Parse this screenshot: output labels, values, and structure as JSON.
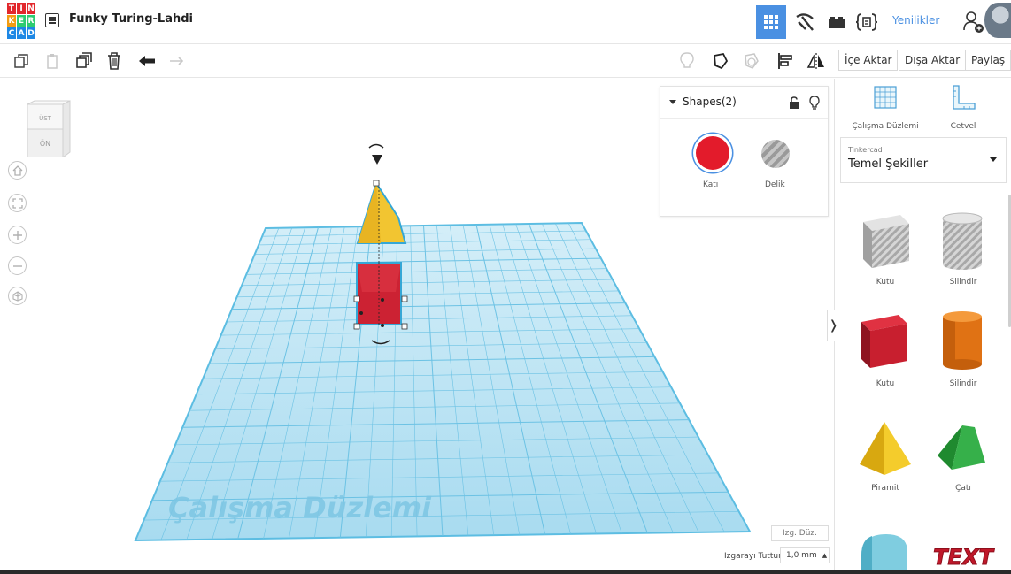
{
  "app": {
    "logo_letters": [
      "T",
      "I",
      "N",
      "K",
      "E",
      "R",
      "C",
      "A",
      "D"
    ],
    "design_title": "Funky Turing-Lahdi"
  },
  "topbar": {
    "news_label": "Yenilikler",
    "views": [
      {
        "name": "3d-design",
        "icon": "grid-icon",
        "active": true
      },
      {
        "name": "circuits",
        "icon": "pickaxe-icon",
        "active": false
      },
      {
        "name": "bricks",
        "icon": "brick-icon",
        "active": false
      },
      {
        "name": "codeblocks",
        "icon": "code-braces-icon",
        "active": false
      }
    ]
  },
  "toolbar": {
    "import_label": "İçe Aktar",
    "export_label": "Dışa Aktar",
    "share_label": "Paylaş"
  },
  "viewcube": {
    "top_label": "ÜST",
    "front_label": "ÖN"
  },
  "workplane": {
    "watermark": "Çalışma Düzlemi"
  },
  "shapes_panel": {
    "title": "Shapes(2)",
    "solid_label": "Katı",
    "hole_label": "Delik",
    "solid_color": "#e31b2b"
  },
  "sidebar": {
    "workplane_tool_label": "Çalışma Düzlemi",
    "ruler_tool_label": "Cetvel",
    "library_source": "Tinkercad",
    "library_name": "Temel Şekiller",
    "shapes": [
      {
        "label": "Kutu",
        "icon": "hole-box-icon"
      },
      {
        "label": "Silindir",
        "icon": "hole-cylinder-icon"
      },
      {
        "label": "Kutu",
        "icon": "box-icon"
      },
      {
        "label": "Silindir",
        "icon": "cylinder-icon"
      },
      {
        "label": "Piramit",
        "icon": "pyramid-icon"
      },
      {
        "label": "Çatı",
        "icon": "roof-icon"
      },
      {
        "label": "",
        "icon": "round-roof-icon"
      },
      {
        "label": "",
        "icon": "text-icon"
      }
    ]
  },
  "grid_controls": {
    "edit_grid_label": "Izg. Düz.",
    "snap_label": "Izgarayı Tuttur",
    "snap_value": "1,0 mm"
  },
  "colors": {
    "accent": "#4a90e2",
    "workplane": "#9fd8ee",
    "box_red": "#cc2233",
    "pyramid_yellow": "#f2c531"
  }
}
